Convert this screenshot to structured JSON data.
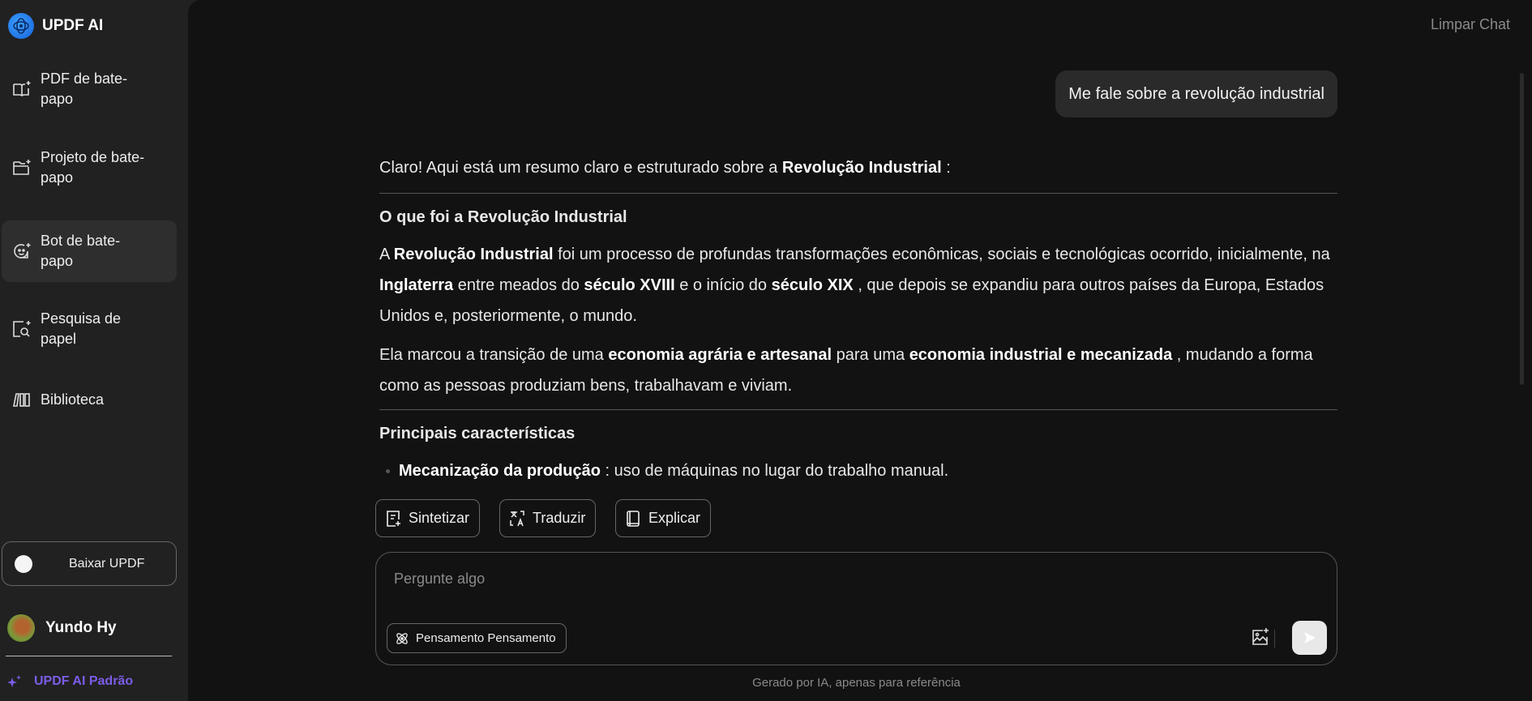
{
  "sidebar": {
    "brand": "UPDF AI",
    "items": [
      {
        "label": "PDF de bate-papo",
        "icon": "book-sparkle-icon"
      },
      {
        "label": "Projeto de bate-papo",
        "icon": "folder-sparkle-icon"
      },
      {
        "label": "Bot de bate-papo",
        "icon": "chat-bot-icon",
        "selected": true
      },
      {
        "label": "Pesquisa de papel",
        "icon": "paper-search-icon"
      },
      {
        "label": "Biblioteca",
        "icon": "library-icon"
      }
    ],
    "download_label": "Baixar UPDF",
    "user_name": "Yundo Hy",
    "plan_label": "UPDF AI Padrão",
    "plan_color": "#7c5ce8"
  },
  "header": {
    "clear_label": "Limpar Chat"
  },
  "chat": {
    "user_message": "Me fale sobre a revolução industrial",
    "intro": [
      {
        "t": "Claro! Aqui está um resumo claro e estruturado sobre a "
      },
      {
        "t": "Revolução Industrial",
        "b": true
      },
      {
        "t": " :"
      }
    ],
    "heading1": "O que foi a Revolução Industrial",
    "para1": [
      {
        "t": "A "
      },
      {
        "t": "Revolução Industrial",
        "b": true
      },
      {
        "t": " foi um processo de profundas transformações econômicas, sociais e tecnológicas ocorrido, inicialmente, na "
      },
      {
        "t": "Inglaterra",
        "b": true
      },
      {
        "t": " entre meados do "
      },
      {
        "t": "século XVIII",
        "b": true
      },
      {
        "t": " e o início do "
      },
      {
        "t": "século XIX",
        "b": true
      },
      {
        "t": " , que depois se expandiu para outros países da Europa, Estados Unidos e, posteriormente, o mundo."
      }
    ],
    "para2": [
      {
        "t": "Ela marcou a transição de uma "
      },
      {
        "t": "economia agrária e artesanal",
        "b": true
      },
      {
        "t": " para uma "
      },
      {
        "t": "economia industrial e mecanizada",
        "b": true
      },
      {
        "t": " , mudando a forma como as pessoas produziam bens, trabalhavam e viviam."
      }
    ],
    "heading2": "Principais características",
    "bullet1": [
      {
        "t": "Mecanização da produção",
        "b": true
      },
      {
        "t": " : uso de máquinas no lugar do trabalho manual."
      }
    ]
  },
  "actions": {
    "summarize": "Sintetizar",
    "translate": "Traduzir",
    "explain": "Explicar"
  },
  "composer": {
    "placeholder": "Pergunte algo",
    "thinking_label": "Pensamento Pensamento"
  },
  "footer": "Gerado por IA, apenas para referência"
}
